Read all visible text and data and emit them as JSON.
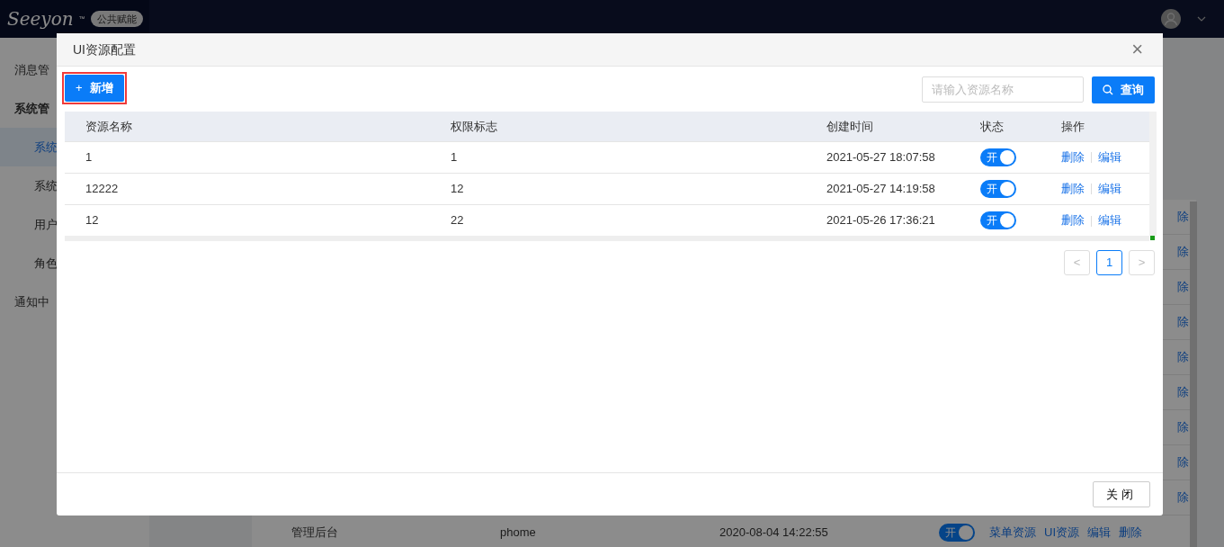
{
  "header": {
    "logo": "Seeyon",
    "logo_mark": "™",
    "badge": "公共赋能"
  },
  "sidebar": {
    "items": [
      {
        "label": "消息管",
        "selected": false
      },
      {
        "label": "系统管",
        "selected": false,
        "children": [
          {
            "label": "系统",
            "selected": true
          },
          {
            "label": "系统",
            "selected": false
          },
          {
            "label": "用户",
            "selected": false
          },
          {
            "label": "角色",
            "selected": false
          }
        ]
      },
      {
        "label": "通知中",
        "selected": false
      }
    ]
  },
  "background_table": {
    "rows": [
      {
        "action_tail": "除"
      },
      {
        "action_tail": "除"
      },
      {
        "action_tail": "除"
      },
      {
        "action_tail": "除"
      },
      {
        "action_tail": "除"
      },
      {
        "action_tail": "除"
      },
      {
        "action_tail": "除"
      },
      {
        "action_tail": "除"
      },
      {
        "action_tail": "除"
      },
      {
        "name": "管理后台",
        "code": "phome",
        "created": "2020-08-04 14:22:55",
        "enabled": true,
        "switch_label": "开",
        "actions": [
          "菜单资源",
          "UI资源",
          "编辑",
          "删除"
        ]
      }
    ]
  },
  "dialog": {
    "title": "UI资源配置",
    "close": "×",
    "add_button": {
      "icon": "+",
      "label": "新增",
      "highlighted": true
    },
    "search": {
      "placeholder": "请输入资源名称"
    },
    "search_button": "查询",
    "table": {
      "columns": [
        "资源名称",
        "权限标志",
        "创建时间",
        "状态",
        "操作"
      ],
      "rows": [
        {
          "name": "1",
          "permission": "1",
          "created": "2021-05-27 18:07:58",
          "enabled": true,
          "switch_label": "开",
          "actions": [
            "删除",
            "编辑"
          ]
        },
        {
          "name": "12222",
          "permission": "12",
          "created": "2021-05-27 14:19:58",
          "enabled": true,
          "switch_label": "开",
          "actions": [
            "删除",
            "编辑"
          ]
        },
        {
          "name": "12",
          "permission": "22",
          "created": "2021-05-26 17:36:21",
          "enabled": true,
          "switch_label": "开",
          "actions": [
            "删除",
            "编辑"
          ]
        }
      ]
    },
    "pagination": {
      "prev": "<",
      "next": ">",
      "pages": [
        {
          "label": "1",
          "selected": true
        }
      ]
    },
    "footer_button": "关闭"
  }
}
